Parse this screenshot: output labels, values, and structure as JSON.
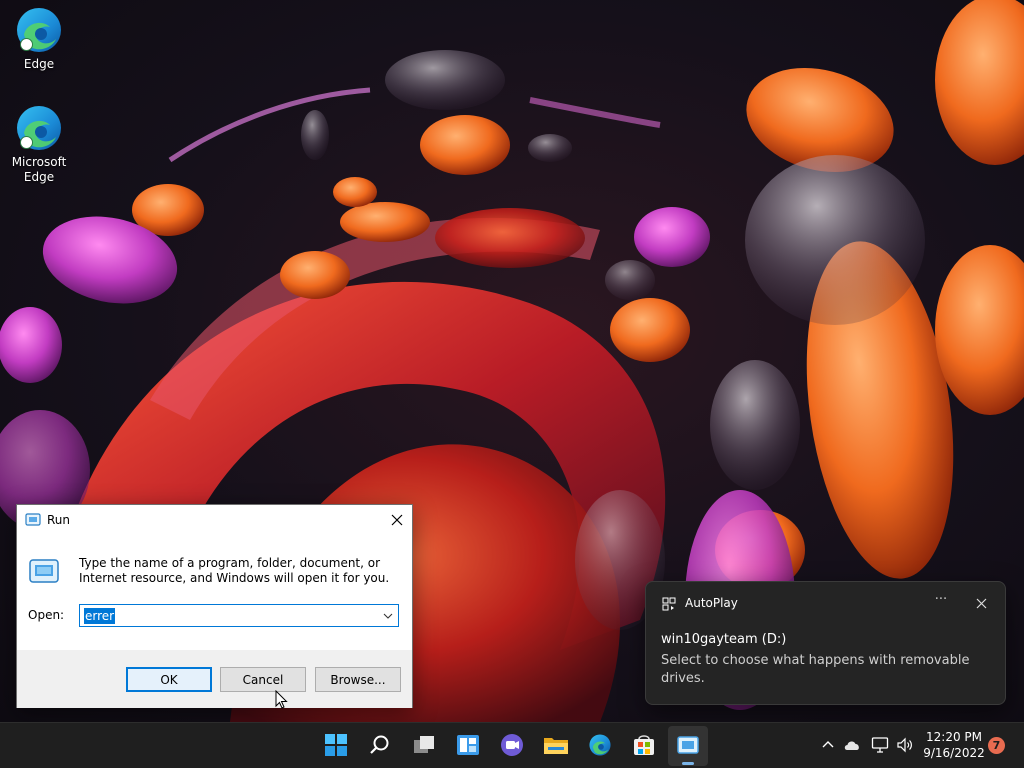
{
  "desktop": {
    "icons": [
      {
        "label": "Edge"
      },
      {
        "label": "Microsoft Edge"
      }
    ]
  },
  "run_dialog": {
    "title": "Run",
    "description": "Type the name of a program, folder, document, or Internet resource, and Windows will open it for you.",
    "open_label": "Open:",
    "open_value": "errer",
    "ok_label": "OK",
    "cancel_label": "Cancel",
    "browse_label": "Browse..."
  },
  "toast": {
    "app_name": "AutoPlay",
    "more_label": "···",
    "heading": "win10gayteam (D:)",
    "message": "Select to choose what happens with removable drives."
  },
  "taskbar": {
    "apps": [
      "start-icon",
      "search-icon",
      "task-view-icon",
      "widgets-icon",
      "chat-icon",
      "file-explorer-icon",
      "edge-icon",
      "store-icon",
      "run-app-icon"
    ],
    "time": "12:20 PM",
    "date": "9/16/2022",
    "notification_count": "7"
  },
  "colors": {
    "accent": "#0078d7",
    "taskbar": "#1f1f1f",
    "toast_bg": "#242424",
    "badge": "#e86b50"
  }
}
